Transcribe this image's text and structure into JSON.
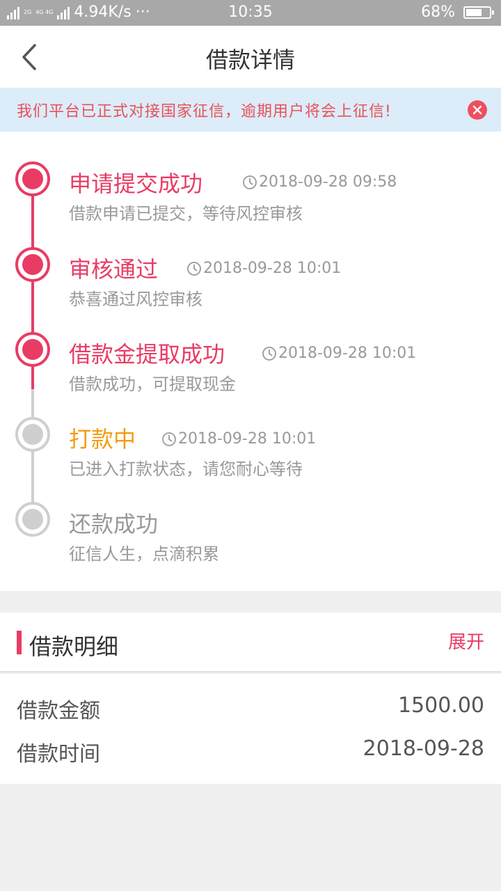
{
  "status_bar": {
    "net1": "2G",
    "net2": "4G 4G",
    "speed": "4.94K/s",
    "dots": "···",
    "time": "10:35",
    "battery": "68%",
    "battery_level": 0.68
  },
  "header": {
    "title": "借款详情",
    "back_icon": "chevron-left-icon"
  },
  "notice": {
    "text": "我们平台已正式对接国家征信，逾期用户将会上征信!",
    "close_icon": "close-icon",
    "color": "#e8505b"
  },
  "timeline": {
    "steps": [
      {
        "title": "申请提交成功",
        "time": "2018-09-28 09:58",
        "desc": "借款申请已提交，等待风控审核",
        "state": "done",
        "color": "#e83c65"
      },
      {
        "title": "审核通过",
        "time": "2018-09-28 10:01",
        "desc": "恭喜通过风控审核",
        "state": "done",
        "color": "#e83c65"
      },
      {
        "title": "借款金提取成功",
        "time": "2018-09-28 10:01",
        "desc": "借款成功，可提取现金",
        "state": "done",
        "color": "#e83c65"
      },
      {
        "title": "打款中",
        "time": "2018-09-28 10:01",
        "desc": "已进入打款状态，请您耐心等待",
        "state": "current",
        "color": "#f39c12"
      },
      {
        "title": "还款成功",
        "time": "",
        "desc": "征信人生，点滴积累",
        "state": "todo",
        "color": "#999999"
      }
    ]
  },
  "detail": {
    "title": "借款明细",
    "toggle": "展开",
    "rows": [
      {
        "label": "借款金额",
        "value": "1500.00"
      },
      {
        "label": "借款时间",
        "value": "2018-09-28"
      }
    ]
  },
  "colors": {
    "accent": "#e83c65",
    "pending": "#f39c12",
    "inactive": "#cfcfcf"
  }
}
